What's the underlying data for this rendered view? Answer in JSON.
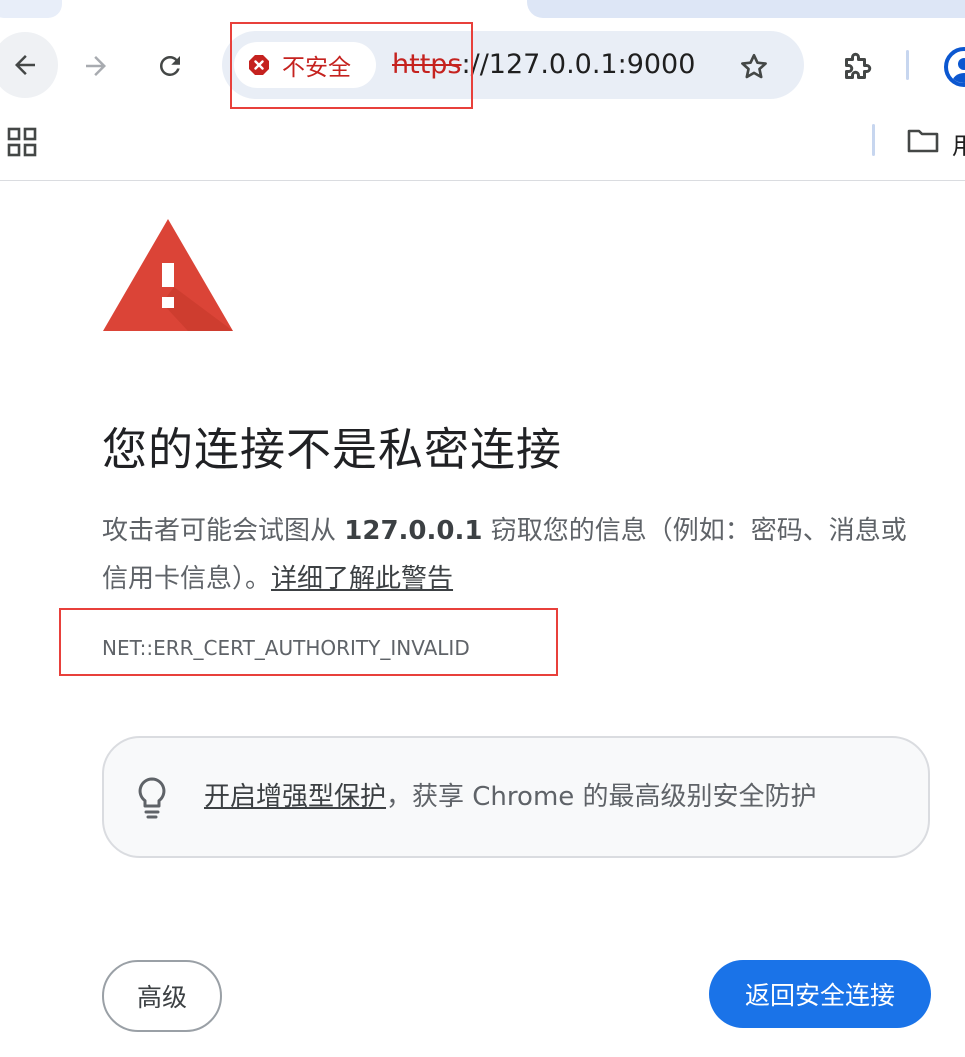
{
  "omnibox": {
    "security_chip_label": "不安全",
    "url_scheme": "https",
    "url_rest": "://127.0.0.1:9000"
  },
  "bookmarks_bar": {
    "folder_label": "用"
  },
  "interstitial": {
    "headline": "您的连接不是私密连接",
    "desc_prefix": "攻击者可能会试图从 ",
    "desc_host": "127.0.0.1",
    "desc_middle": " 窃取您的信息（例如：密码、消息或信用卡信息）。",
    "learn_more_link": "详细了解此警告",
    "error_code": "NET::ERR_CERT_AUTHORITY_INVALID",
    "enhanced_protection_link": "开启增强型保护",
    "enhanced_protection_rest": "，获享 Chrome 的最高级别安全防护",
    "advanced_button": "高级",
    "back_to_safety_button": "返回安全连接"
  },
  "colors": {
    "danger_red": "#c5221f",
    "warning_triangle": "#db4437",
    "primary_button": "#1a73e8",
    "highlight_annotation": "#e8403b"
  },
  "icons": [
    "back-arrow-icon",
    "forward-arrow-icon",
    "reload-icon",
    "not-secure-icon",
    "star-icon",
    "extensions-puzzle-icon",
    "profile-avatar-icon",
    "apps-grid-icon",
    "folder-icon",
    "warning-triangle-icon",
    "lightbulb-icon"
  ]
}
